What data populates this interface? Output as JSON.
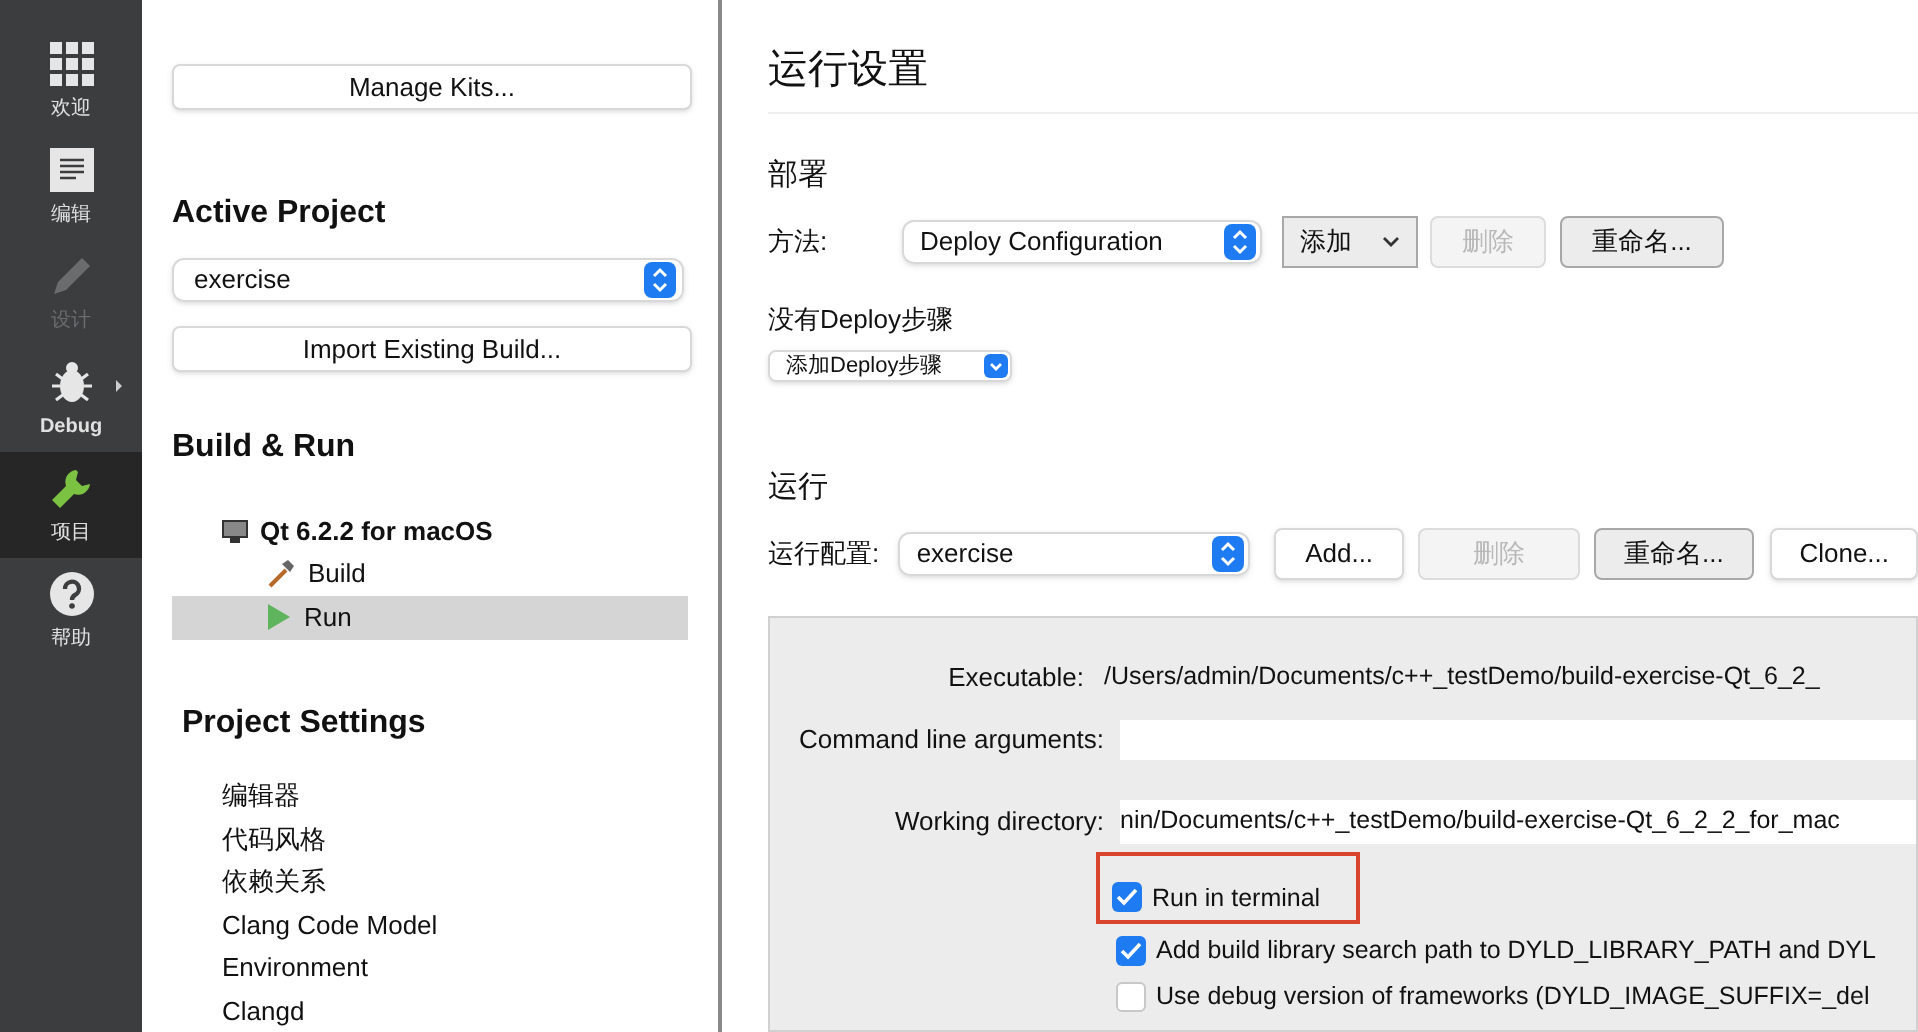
{
  "mode_bar": [
    {
      "kind": "grid",
      "label": "欢迎",
      "selected": false,
      "disabled": false
    },
    {
      "kind": "document",
      "label": "编辑",
      "selected": false,
      "disabled": false
    },
    {
      "kind": "pencil",
      "label": "设计",
      "selected": false,
      "disabled": true
    },
    {
      "kind": "bug",
      "label": "Debug",
      "selected": false,
      "disabled": false
    },
    {
      "kind": "wrench",
      "label": "项目",
      "selected": true,
      "disabled": false
    },
    {
      "kind": "help",
      "label": "帮助",
      "selected": false,
      "disabled": false
    }
  ],
  "project_panel": {
    "manage_kits": "Manage Kits...",
    "active_project_heading": "Active Project",
    "active_project": "exercise",
    "import_build": "Import Existing Build...",
    "build_run_heading": "Build & Run",
    "kit": "Qt 6.2.2 for macOS",
    "kit_items": [
      {
        "kind": "build",
        "label": "Build",
        "selected": false
      },
      {
        "kind": "run",
        "label": "Run",
        "selected": true
      }
    ],
    "project_settings_heading": "Project Settings",
    "settings_items": [
      "编辑器",
      "代码风格",
      "依赖关系",
      "Clang Code Model",
      "Environment",
      "Clangd"
    ]
  },
  "run_settings": {
    "title": "运行设置",
    "deploy": {
      "heading": "部署",
      "method_label": "方法:",
      "method": "Deploy Configuration",
      "add": "添加",
      "remove": "删除",
      "rename": "重命名...",
      "no_steps": "没有Deploy步骤",
      "add_step": "添加Deploy步骤"
    },
    "run": {
      "heading": "运行",
      "config_label": "运行配置:",
      "config": "exercise",
      "buttons": [
        {
          "label": "Add...",
          "disabled": false
        },
        {
          "label": "删除",
          "disabled": true
        },
        {
          "label": "重命名...",
          "disabled": false
        },
        {
          "label": "Clone...",
          "disabled": false
        }
      ],
      "executable_label": "Executable:",
      "executable": "/Users/admin/Documents/c++_testDemo/build-exercise-Qt_6_2_",
      "arguments_label": "Command line arguments:",
      "working_dir_label": "Working directory:",
      "working_dir": "nin/Documents/c++_testDemo/build-exercise-Qt_6_2_2_for_mac",
      "options": [
        {
          "label": "Run in terminal",
          "checked": true,
          "highlighted": true
        },
        {
          "label": "Add build library search path to DYLD_LIBRARY_PATH and DYL",
          "checked": true,
          "highlighted": false
        },
        {
          "label": "Use debug version of frameworks (DYLD_IMAGE_SUFFIX=_del",
          "checked": false,
          "highlighted": false
        }
      ]
    }
  }
}
